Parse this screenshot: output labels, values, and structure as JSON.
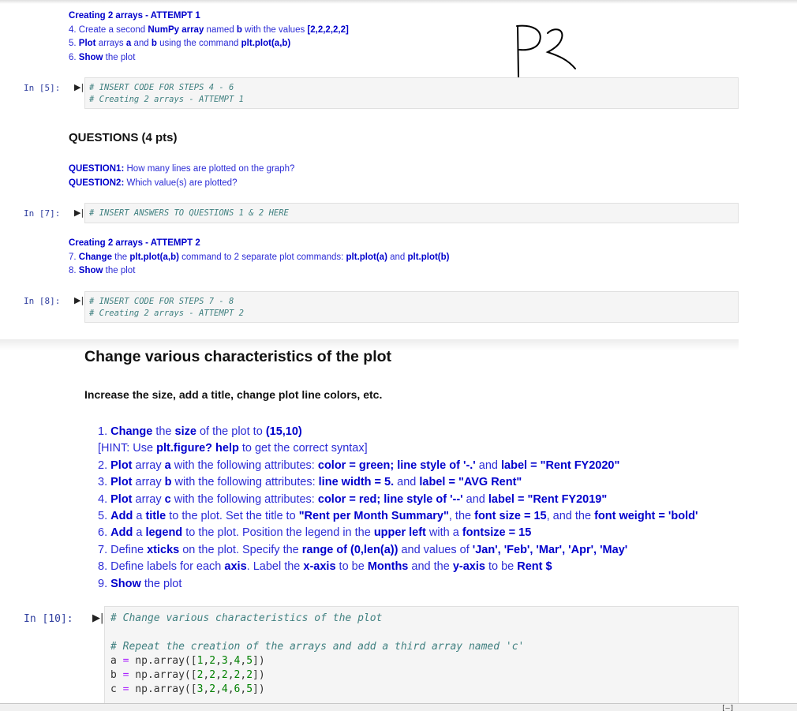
{
  "attempt1": {
    "title": "Creating 2 arrays - ATTEMPT 1",
    "steps": [
      {
        "num": "4.",
        "parts": [
          [
            "t",
            "Create a second "
          ],
          [
            "b",
            "NumPy array"
          ],
          [
            "t",
            " named "
          ],
          [
            "b",
            "b"
          ],
          [
            "t",
            " with the values "
          ],
          [
            "b",
            "[2,2,2,2,2]"
          ]
        ]
      },
      {
        "num": "5.",
        "parts": [
          [
            "b",
            "Plot"
          ],
          [
            "t",
            " arrays "
          ],
          [
            "b",
            "a"
          ],
          [
            "t",
            " and "
          ],
          [
            "b",
            "b"
          ],
          [
            "t",
            " using the command "
          ],
          [
            "b",
            "plt.plot(a,b)"
          ]
        ]
      },
      {
        "num": "6.",
        "parts": [
          [
            "b",
            "Show"
          ],
          [
            "t",
            " the plot"
          ]
        ]
      }
    ]
  },
  "handwriting": "P2",
  "cell5": {
    "prompt": "In [5]:",
    "lines": [
      "# INSERT CODE FOR STEPS 4 - 6",
      "# Creating 2 arrays - ATTEMPT 1"
    ]
  },
  "questions": {
    "heading": "QUESTIONS (4 pts)",
    "items": [
      {
        "label": "QUESTION1:",
        "text": " How many lines are plotted on the graph?"
      },
      {
        "label": "QUESTION2:",
        "text": " Which value(s) are plotted?"
      }
    ]
  },
  "cell7": {
    "prompt": "In [7]:",
    "lines": [
      "# INSERT ANSWERS TO QUESTIONS 1 & 2 HERE"
    ]
  },
  "attempt2": {
    "title": "Creating 2 arrays - ATTEMPT 2",
    "steps": [
      {
        "num": "7.",
        "parts": [
          [
            "b",
            "Change"
          ],
          [
            "t",
            " the "
          ],
          [
            "b",
            "plt.plot(a,b)"
          ],
          [
            "t",
            " command to 2 separate plot commands: "
          ],
          [
            "b",
            "plt.plot(a)"
          ],
          [
            "t",
            " and "
          ],
          [
            "b",
            "plt.plot(b)"
          ]
        ]
      },
      {
        "num": "8.",
        "parts": [
          [
            "b",
            "Show"
          ],
          [
            "t",
            " the plot"
          ]
        ]
      }
    ]
  },
  "cell8": {
    "prompt": "In [8]:",
    "lines": [
      "# INSERT CODE FOR STEPS 7 - 8",
      "# Creating 2 arrays - ATTEMPT 2"
    ]
  },
  "section": {
    "heading": "Change various characteristics of the plot",
    "subheading": "Increase the size, add a title, change plot line colors, etc.",
    "steps": [
      [
        [
          "t",
          "1. "
        ],
        [
          "b",
          "Change"
        ],
        [
          "t",
          " the "
        ],
        [
          "b",
          "size"
        ],
        [
          "t",
          " of the plot to "
        ],
        [
          "b",
          "(15,10)"
        ]
      ],
      [
        [
          "t",
          "[HINT: Use "
        ],
        [
          "b",
          "plt.figure? help"
        ],
        [
          "t",
          " to get the correct syntax]"
        ]
      ],
      [
        [
          "t",
          "2. "
        ],
        [
          "b",
          "Plot"
        ],
        [
          "t",
          " array "
        ],
        [
          "b",
          "a"
        ],
        [
          "t",
          " with the following attributes: "
        ],
        [
          "b",
          "color = green; line style of '-.'"
        ],
        [
          "t",
          " and "
        ],
        [
          "b",
          "label = \"Rent FY2020\""
        ]
      ],
      [
        [
          "t",
          "3. "
        ],
        [
          "b",
          "Plot"
        ],
        [
          "t",
          " array "
        ],
        [
          "b",
          "b"
        ],
        [
          "t",
          " with the following attributes: "
        ],
        [
          "b",
          "line width = 5."
        ],
        [
          "t",
          " and "
        ],
        [
          "b",
          "label = \"AVG Rent\""
        ]
      ],
      [
        [
          "t",
          "4. "
        ],
        [
          "b",
          "Plot"
        ],
        [
          "t",
          " array "
        ],
        [
          "b",
          "c"
        ],
        [
          "t",
          " with the following attributes: "
        ],
        [
          "b",
          "color = red; line style of '--'"
        ],
        [
          "t",
          " and "
        ],
        [
          "b",
          "label = \"Rent FY2019\""
        ]
      ],
      [
        [
          "t",
          "5. "
        ],
        [
          "b",
          "Add"
        ],
        [
          "t",
          " a "
        ],
        [
          "b",
          "title"
        ],
        [
          "t",
          " to the plot. Set the title to "
        ],
        [
          "b",
          "\"Rent per Month Summary\""
        ],
        [
          "t",
          ", the "
        ],
        [
          "b",
          "font size = 15"
        ],
        [
          "t",
          ", and the "
        ],
        [
          "b",
          "font weight = 'bold'"
        ]
      ],
      [
        [
          "t",
          "6. "
        ],
        [
          "b",
          "Add"
        ],
        [
          "t",
          " a "
        ],
        [
          "b",
          "legend"
        ],
        [
          "t",
          " to the plot. Position the legend in the "
        ],
        [
          "b",
          "upper left"
        ],
        [
          "t",
          " with a "
        ],
        [
          "b",
          "fontsize = 15"
        ]
      ],
      [
        [
          "t",
          "7. Define "
        ],
        [
          "b",
          "xticks"
        ],
        [
          "t",
          " on the plot. Specify the "
        ],
        [
          "b",
          "range of (0,len(a))"
        ],
        [
          "t",
          " and values of "
        ],
        [
          "b",
          "'Jan', 'Feb', 'Mar', 'Apr', 'May'"
        ]
      ],
      [
        [
          "t",
          "8. Define labels for each "
        ],
        [
          "b",
          "axis"
        ],
        [
          "t",
          ". Label the "
        ],
        [
          "b",
          "x-axis"
        ],
        [
          "t",
          " to be "
        ],
        [
          "b",
          "Months"
        ],
        [
          "t",
          " and the "
        ],
        [
          "b",
          "y-axis"
        ],
        [
          "t",
          " to be "
        ],
        [
          "b",
          "Rent $"
        ]
      ],
      [
        [
          "t",
          "9. "
        ],
        [
          "b",
          "Show"
        ],
        [
          "t",
          " the plot"
        ]
      ]
    ]
  },
  "cell10": {
    "prompt": "In [10]:",
    "comment1": "# Change various characteristics of the plot",
    "comment2": "# Repeat the creation of the arrays and add a third array named 'c'",
    "arrays": [
      {
        "name": "a",
        "values": "1,2,3,4,5"
      },
      {
        "name": "b",
        "values": "2,2,2,2,2"
      },
      {
        "name": "c",
        "values": "3,2,4,6,5"
      }
    ]
  },
  "icons": {
    "run": "▶|",
    "expand": "[—]"
  }
}
